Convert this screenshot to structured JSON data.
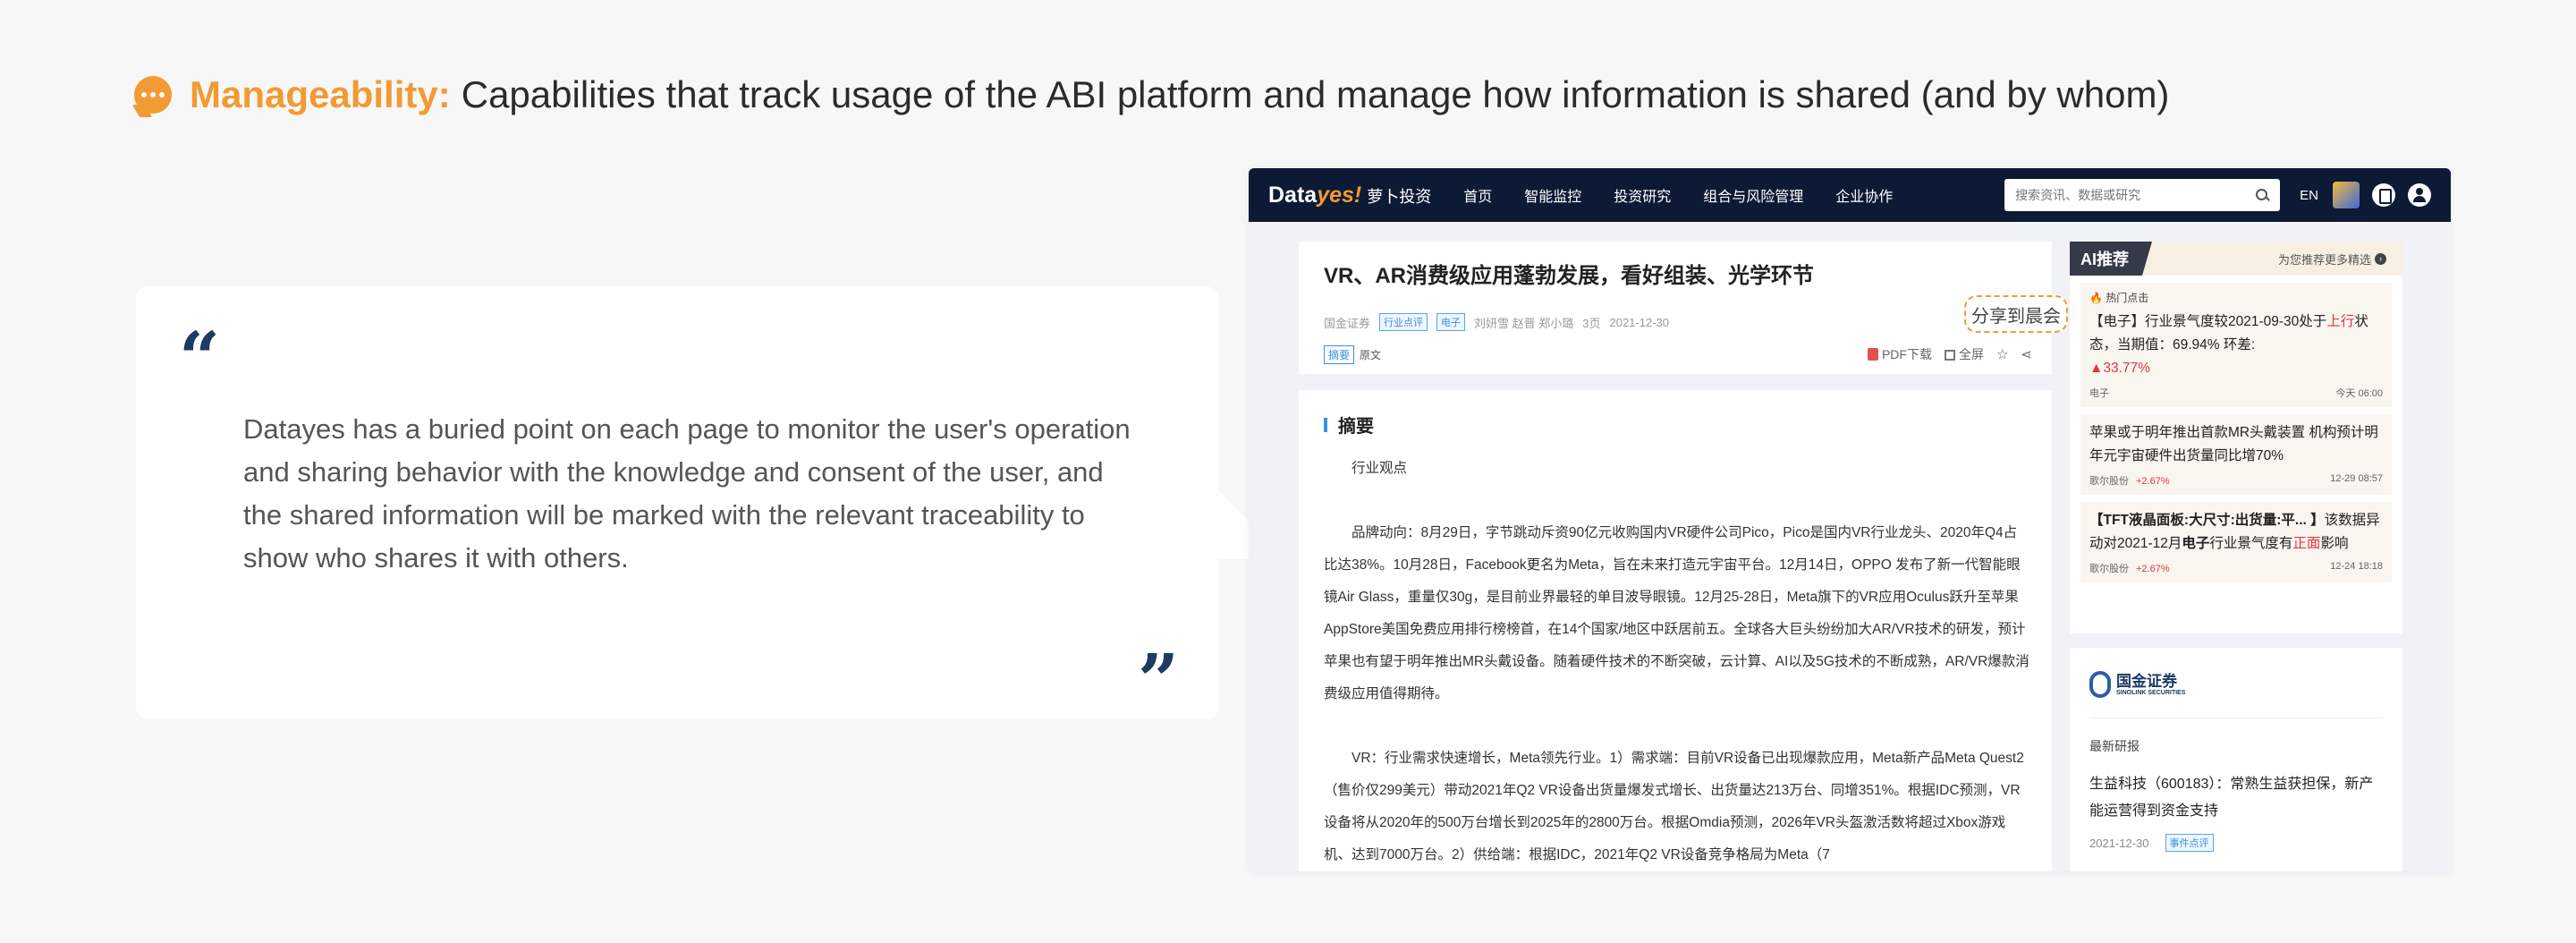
{
  "heading": {
    "keyword": "Manageability:",
    "description": "Capabilities that track usage of the ABI platform and manage how information is shared (and by whom)"
  },
  "quote": {
    "open_mark": "“",
    "close_mark": "”",
    "text": "Datayes has a buried point on each page to monitor the user's operation and sharing behavior with the knowledge and consent of the user, and the shared information will be marked with the relevant traceability to show who shares it with others."
  },
  "app": {
    "logo": {
      "data": "Data",
      "yes": "yes!",
      "cn": "萝卜投资"
    },
    "nav_items": [
      "首页",
      "智能监控",
      "投资研究",
      "组合与风险管理",
      "企业协作"
    ],
    "search_placeholder": "搜索资讯、数据或研究",
    "lang": "EN",
    "article": {
      "title": "VR、AR消费级应用蓬勃发展，看好组装、光学环节",
      "meta": {
        "broker": "国金证券",
        "tag1": "行业点评",
        "tag2": "电子",
        "authors": "刘妍雪 赵晋 郑小璐",
        "pages": "3页",
        "date": "2021-12-30"
      },
      "tabs": {
        "summary": "摘要",
        "original": "原文"
      },
      "tools": {
        "pdf": "PDF下载",
        "fullscreen": "全屏",
        "star": "☆",
        "share": "⋖"
      },
      "share_tip": "分享到晨会",
      "section_title": "摘要",
      "paragraphs": [
        "行业观点",
        "品牌动向：8月29日，字节跳动斥资90亿元收购国内VR硬件公司Pico，Pico是国内VR行业龙头、2020年Q4占比达38%。10月28日，Facebook更名为Meta，旨在未来打造元宇宙平台。12月14日，OPPO 发布了新一代智能眼镜Air Glass，重量仅30g，是目前业界最轻的单目波导眼镜。12月25-28日，Meta旗下的VR应用Oculus跃升至苹果AppStore美国免费应用排行榜榜首，在14个国家/地区中跃居前五。全球各大巨头纷纷加大AR/VR技术的研发，预计苹果也有望于明年推出MR头戴设备。随着硬件技术的不断突破，云计算、AI以及5G技术的不断成熟，AR/VR爆款消费级应用值得期待。",
        "VR：行业需求快速增长，Meta领先行业。1）需求端：目前VR设备已出现爆款应用，Meta新产品Meta Quest2（售价仅299美元）带动2021年Q2 VR设备出货量爆发式增长、出货量达213万台、同增351%。根据IDC预测，VR设备将从2020年的500万台增长到2025年的2800万台。根据Omdia预测，2026年VR头盔激活数将超过Xbox游戏机、达到7000万台。2）供给端：根据IDC，2021年Q2 VR设备竞争格局为Meta（7"
      ]
    },
    "ai": {
      "badge": "AI推荐",
      "more": "为您推荐更多精选",
      "items": [
        {
          "hot": "热门点击",
          "text_a": "【电子】行业景气度较2021-09-30处于",
          "text_red": "上行",
          "text_b": "状态，当期值：69.94%  环差:",
          "text_red2": "▲33.77%",
          "foot_left": "电子",
          "foot_right": "今天 06:00"
        },
        {
          "text": "苹果或于明年推出首款MR头戴装置 机构预计明年元宇宙硬件出货量同比增70%",
          "foot_left": "歌尔股份",
          "foot_change": "+2.67%",
          "foot_right": "12-29 08:57"
        },
        {
          "text_bold": "【TFT液晶面板:大尺寸:出货量:平... 】",
          "text_a": "该数据异动对2021-12月",
          "text_bold2": "电子",
          "text_b": "行业景气度有",
          "text_red": "正面",
          "text_c": "影响",
          "foot_left": "歌尔股份",
          "foot_change": "+2.67%",
          "foot_right": "12-24 18:18"
        }
      ]
    },
    "broker": {
      "name_cn": "国金证券",
      "name_en": "SINOLINK SECURITIES",
      "latest": "最新研报",
      "item": "生益科技（600183）：常熟生益获担保，新产能运营得到资金支持",
      "date": "2021-12-30",
      "tag": "事件点评"
    }
  }
}
